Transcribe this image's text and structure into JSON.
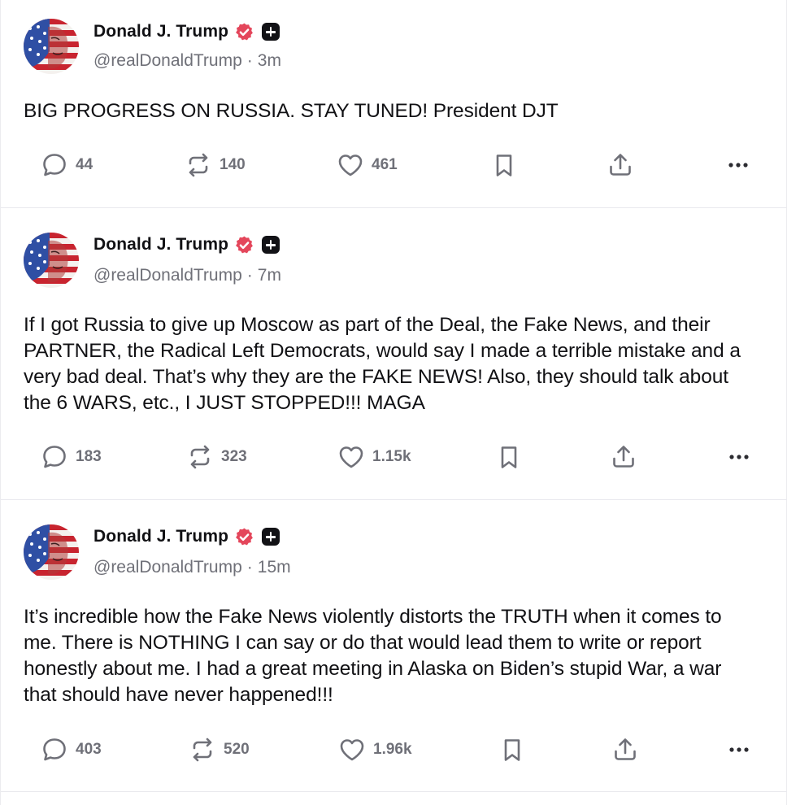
{
  "posts": [
    {
      "author": "Donald J. Trump",
      "handle": "@realDonaldTrump",
      "separator": "·",
      "time": "3m",
      "text": "BIG PROGRESS ON RUSSIA. STAY TUNED! President DJT",
      "replies": "44",
      "retruths": "140",
      "likes": "461"
    },
    {
      "author": "Donald J. Trump",
      "handle": "@realDonaldTrump",
      "separator": "·",
      "time": "7m",
      "text": "If I got Russia to give up Moscow as part of the Deal, the Fake News, and their PARTNER, the Radical Left Democrats, would say I made a terrible mistake and a very bad deal. That’s why they are the FAKE NEWS! Also, they should talk about the 6 WARS, etc., I JUST STOPPED!!! MAGA",
      "replies": "183",
      "retruths": "323",
      "likes": "1.15k"
    },
    {
      "author": "Donald J. Trump",
      "handle": "@realDonaldTrump",
      "separator": "·",
      "time": "15m",
      "text": "It’s incredible how the Fake News violently distorts the TRUTH when it comes to me. There is NOTHING I can say or do that would lead them to write or report honestly about me. I had a great meeting in Alaska on Biden’s stupid War, a war that should have never happened!!!",
      "replies": "403",
      "retruths": "520",
      "likes": "1.96k"
    }
  ],
  "icons": {
    "reply": "reply-icon",
    "retruth": "retruth-icon",
    "like": "heart-icon",
    "bookmark": "bookmark-icon",
    "share": "share-icon",
    "more": "more-icon",
    "verified": "verified-badge-icon",
    "plus": "plus-badge-icon"
  },
  "colors": {
    "verified_badge": "#e4465b",
    "muted_text": "#6f7078",
    "text": "#111114"
  }
}
